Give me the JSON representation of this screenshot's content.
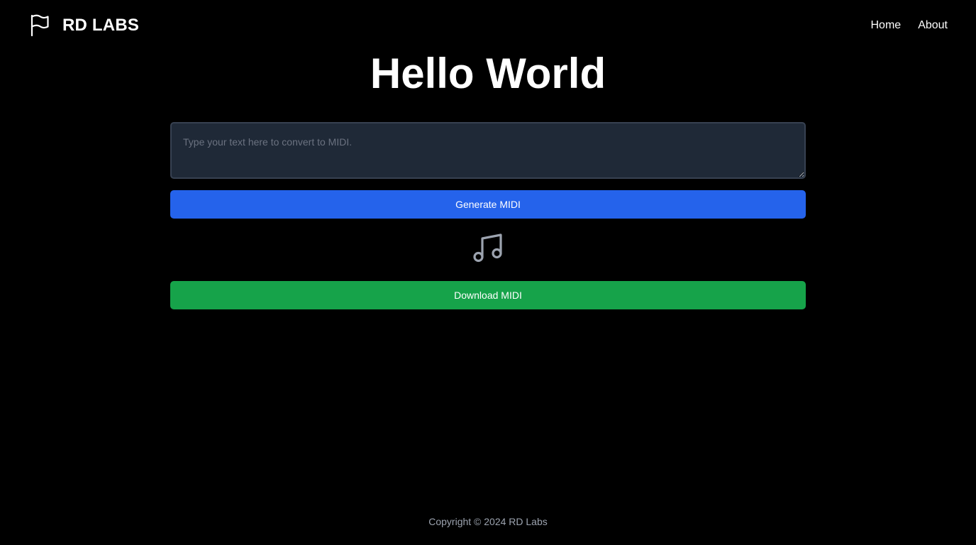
{
  "navbar": {
    "brand_icon": "flag-icon",
    "brand_name": "RD LABS",
    "links": [
      {
        "label": "Home"
      },
      {
        "label": "About"
      }
    ]
  },
  "main": {
    "title": "Hello World",
    "input": {
      "value": "",
      "placeholder": "Type your text here to convert to MIDI."
    },
    "generate_label": "Generate MIDI",
    "music_icon": "music-note-icon",
    "download_label": "Download MIDI"
  },
  "footer": {
    "copyright": "Copyright © 2024 RD Labs"
  },
  "colors": {
    "background": "#000000",
    "input_background": "#1f2937",
    "generate_button": "#2563eb",
    "download_button": "#16a34a",
    "icon_gray": "#9ca3af"
  }
}
